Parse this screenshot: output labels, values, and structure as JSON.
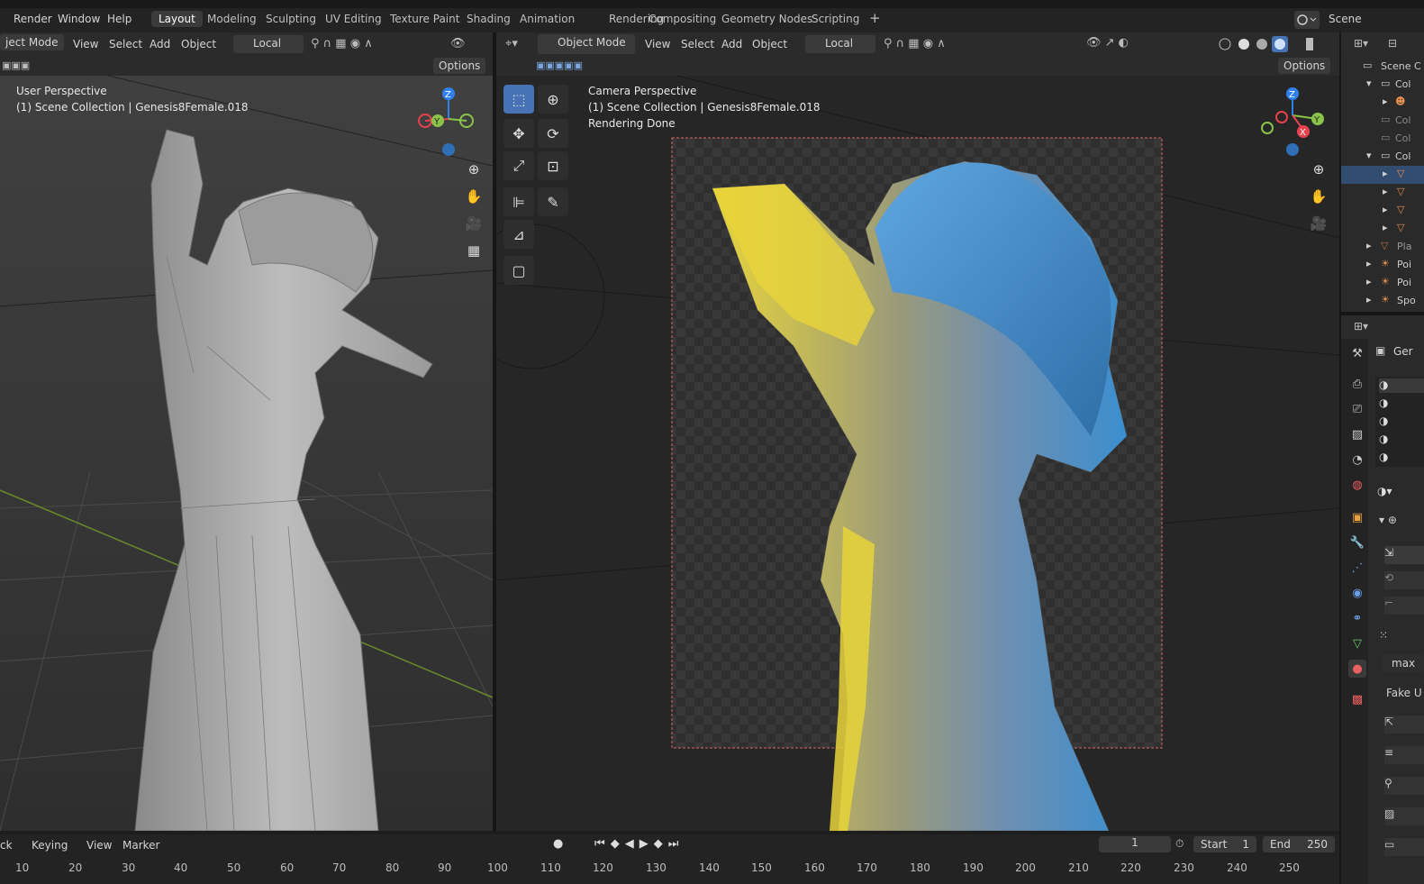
{
  "menubar": {
    "menus": [
      "Render",
      "Window",
      "Help"
    ],
    "workspaces": [
      "Layout",
      "Modeling",
      "Sculpting",
      "UV Editing",
      "Texture Paint",
      "Shading",
      "Animation",
      "Rendering",
      "Compositing",
      "Geometry Nodes",
      "Scripting"
    ],
    "active_workspace": "Layout",
    "add_tab": "+",
    "scene_label": "Scene"
  },
  "left_viewport": {
    "mode": "ject Mode",
    "menus": [
      "View",
      "Select",
      "Add",
      "Object"
    ],
    "transform_orientation": "Local",
    "options": "Options",
    "overlay_line1": "User Perspective",
    "overlay_line2": "(1) Scene Collection | Genesis8Female.018"
  },
  "right_viewport": {
    "mode": "Object Mode",
    "menus": [
      "View",
      "Select",
      "Add",
      "Object"
    ],
    "transform_orientation": "Local",
    "options": "Options",
    "overlay_line1": "Camera Perspective",
    "overlay_line2": "(1) Scene Collection | Genesis8Female.018",
    "overlay_line3": "Rendering Done"
  },
  "gizmo": {
    "z": "Z",
    "y": "Y",
    "x": "X"
  },
  "timeline": {
    "menus": [
      "ck",
      "Keying",
      "View",
      "Marker"
    ],
    "current_frame": "1",
    "start_label": "Start",
    "start_value": "1",
    "end_label": "End",
    "end_value": "250",
    "ticks": [
      "10",
      "20",
      "30",
      "40",
      "50",
      "60",
      "70",
      "80",
      "90",
      "100",
      "110",
      "120",
      "130",
      "140",
      "150",
      "160",
      "170",
      "180",
      "190",
      "200",
      "210",
      "220",
      "230",
      "240",
      "250"
    ]
  },
  "outliner": {
    "header": "Scene C",
    "rows": [
      "Col",
      "",
      "Col",
      "Col",
      "Col",
      "",
      "",
      "",
      "",
      "Pla",
      "Poi",
      "Poi",
      "Spo"
    ]
  },
  "properties": {
    "object_name": "Ger",
    "field_max": "max",
    "fake_user": "Fake U"
  },
  "colors": {
    "accent": "#4772b3",
    "axis_x": "#e8424c",
    "axis_y": "#8bc34a",
    "axis_z": "#2f80ed",
    "render_border": "#d96a6a",
    "light_yellow": "#e8d43a",
    "light_blue": "#3a8fd0"
  }
}
